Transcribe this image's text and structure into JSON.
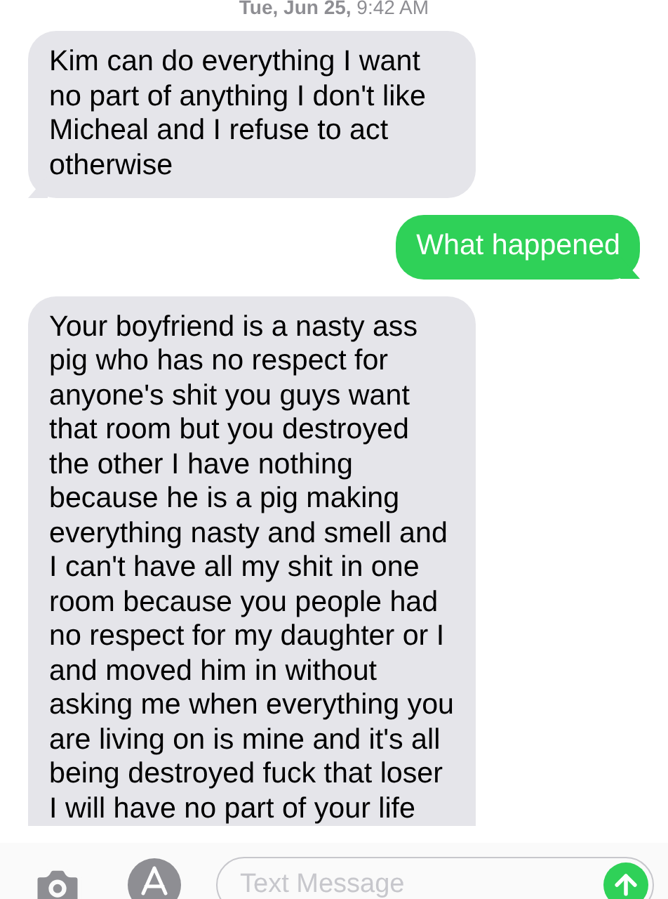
{
  "timestamp": "**Tue, Jun 25,** 9:42 AM",
  "messages": [
    {
      "kind": "incoming",
      "text": "Kim can do everything I want no part of anything I don't like Micheal and I refuse to act otherwise",
      "tail": true,
      "cut_off": false
    },
    {
      "kind": "outgoing",
      "text": "What happened",
      "tail": true,
      "cut_off": false
    },
    {
      "kind": "incoming",
      "text": "Your boyfriend is a nasty ass pig who has no respect for anyone's shit you guys want that room but you destroyed the other I have nothing because he is a pig making everything nasty and smell and I can't have all my shit in one room because you people had no respect for my daughter or I and moved him in without asking me when everything you are living on is mine and it's all being destroyed fuck that loser I will have no part of your life",
      "tail": false,
      "cut_off": true
    }
  ],
  "composer": {
    "placeholder": "Text Message"
  }
}
